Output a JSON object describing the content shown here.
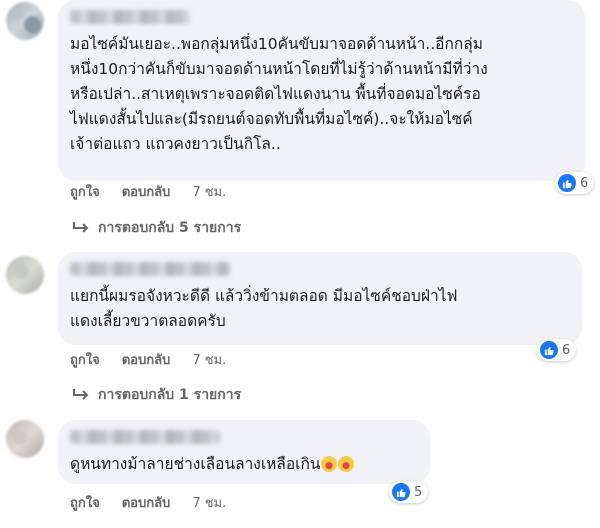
{
  "comments": [
    {
      "text": "มอไซค์มันเยอะ..พอกลุ่มหนึ่ง10คันขับมาจอดด้านหน้า..อีกกลุ่ม\nหนึ่ง10กว่าคันก็ขับมาจอดด้านหน้าโดยที่ไม่รู้ว่าด้านหน้ามีที่ว่าง\nหรือเปล่า..สาเหตุเพราะจอดติดไฟแดงนาน พื้นที่จอดมอไซค์รอ\nไฟแดงสั้นไปและ(มีรถยนต์จอดทับพื้นที่มอไซค์)..จะให้มอไซค์\nเจ้าต่อแถว แถวคงยาวเป็นกิโล..",
      "reaction_count": "6",
      "like_label": "ถูกใจ",
      "reply_label": "ตอบกลับ",
      "time": "7 ชม.",
      "replies_label": "การตอบกลับ 5 รายการ"
    },
    {
      "text": "แยกนี้ผมรอจังหวะดีดี แล้ววิ่งข้ามตลอด มีมอไซค์ชอบฝ่าไฟ\nแดงเลี้ยวขวาตลอดครับ",
      "reaction_count": "6",
      "like_label": "ถูกใจ",
      "reply_label": "ตอบกลับ",
      "time": "7 ชม.",
      "replies_label": "การตอบกลับ 1 รายการ"
    },
    {
      "text": "ดูหนทางม้าลายช่างเลือนลางเหลือเกิน",
      "reaction_count": "5",
      "like_label": "ถูกใจ",
      "reply_label": "ตอบกลับ",
      "time": "7 ชม."
    }
  ],
  "colors": {
    "bubble": "#f0f2f5",
    "meta_text": "#65676b",
    "like_blue": "#1877f2"
  },
  "icons": {
    "like": "thumbs-up-icon",
    "reply": "reply-arrow-icon",
    "emoji": "laughing-tears-emoji"
  }
}
